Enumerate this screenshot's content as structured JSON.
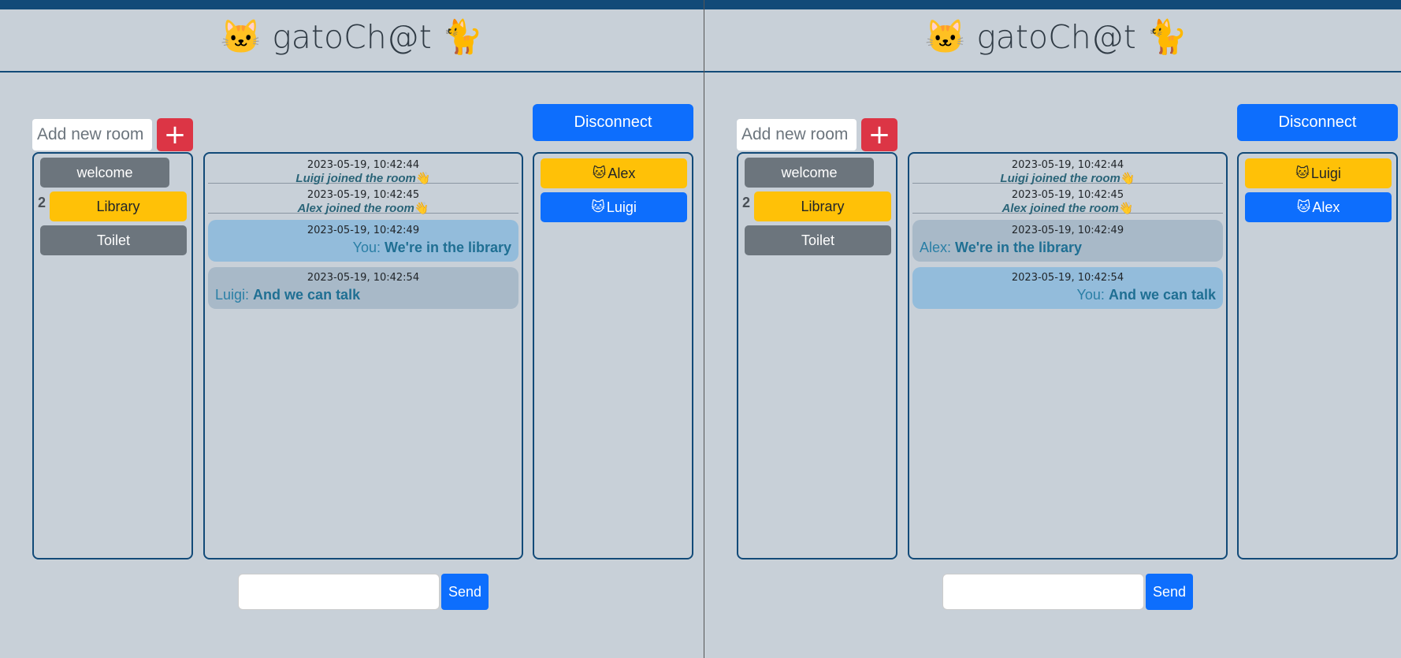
{
  "colors": {
    "top_bar": "#124a78",
    "background": "#c8d0d8",
    "danger": "#dc3545",
    "primary": "#0d6efd",
    "warning": "#ffc107",
    "secondary": "#6c757d",
    "my_bubble": "#93bcdb",
    "other_bubble": "#a8b9c8"
  },
  "panes": [
    {
      "brand": {
        "icon_left": "🐱",
        "title": "gatoCh@t",
        "icon_right": "🐈"
      },
      "room_input_placeholder": "Add new room",
      "add_room_icon": "+",
      "disconnect_label": "Disconnect",
      "rooms": [
        {
          "name": "welcome",
          "count": ""
        },
        {
          "name": "Library",
          "count": "2"
        },
        {
          "name": "Toilet",
          "count": ""
        }
      ],
      "messages": [
        {
          "time": "2023-05-19, 10:42:44",
          "text": "Luigi joined the room",
          "icon": "👋"
        },
        {
          "time": "2023-05-19, 10:42:45",
          "text": "Alex joined the room",
          "icon": "👋"
        },
        {
          "time": "2023-05-19, 10:42:49",
          "sender": "You:",
          "text": "We're in the library"
        },
        {
          "time": "2023-05-19, 10:42:54",
          "sender": "Luigi:",
          "text": "And we can talk"
        }
      ],
      "users": [
        {
          "icon": "🐱",
          "name": "Alex"
        },
        {
          "icon": "🐱",
          "name": "Luigi"
        }
      ],
      "send_label": "Send"
    },
    {
      "brand": {
        "icon_left": "🐱",
        "title": "gatoCh@t",
        "icon_right": "🐈"
      },
      "room_input_placeholder": "Add new room",
      "add_room_icon": "+",
      "disconnect_label": "Disconnect",
      "rooms": [
        {
          "name": "welcome",
          "count": ""
        },
        {
          "name": "Library",
          "count": "2"
        },
        {
          "name": "Toilet",
          "count": ""
        }
      ],
      "messages": [
        {
          "time": "2023-05-19, 10:42:44",
          "text": "Luigi joined the room",
          "icon": "👋"
        },
        {
          "time": "2023-05-19, 10:42:45",
          "text": "Alex joined the room",
          "icon": "👋"
        },
        {
          "time": "2023-05-19, 10:42:49",
          "sender": "Alex:",
          "text": "We're in the library"
        },
        {
          "time": "2023-05-19, 10:42:54",
          "sender": "You:",
          "text": "And we can talk"
        }
      ],
      "users": [
        {
          "icon": "🐱",
          "name": "Luigi"
        },
        {
          "icon": "🐱",
          "name": "Alex"
        }
      ],
      "send_label": "Send"
    }
  ]
}
